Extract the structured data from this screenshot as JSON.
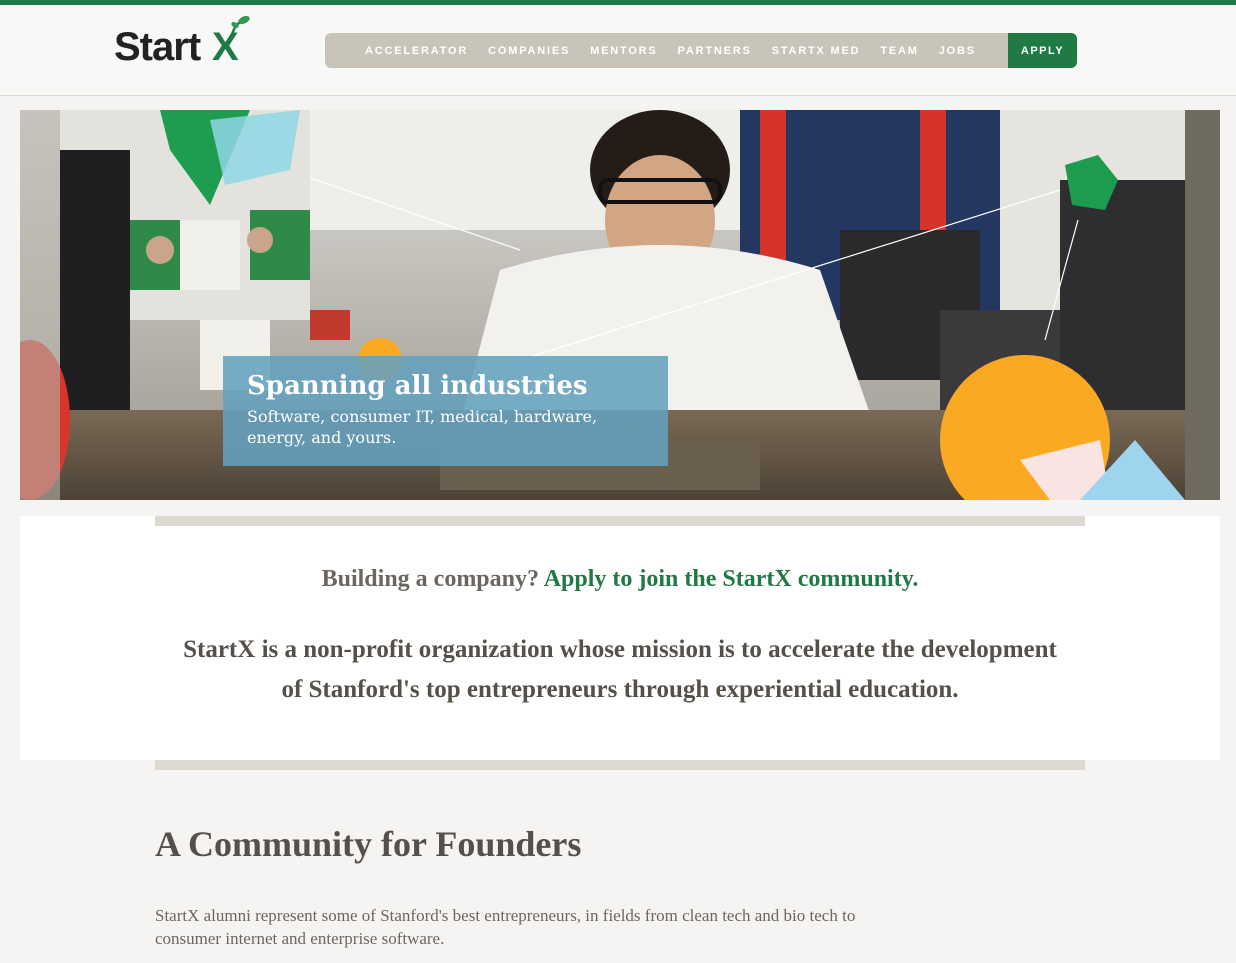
{
  "logo": {
    "text": "Start",
    "x_letter": "X",
    "icon": "sprout-leaf-icon"
  },
  "nav": {
    "items": [
      {
        "label": "ACCELERATOR"
      },
      {
        "label": "COMPANIES"
      },
      {
        "label": "MENTORS"
      },
      {
        "label": "PARTNERS"
      },
      {
        "label": "STARTX MED"
      },
      {
        "label": "TEAM"
      },
      {
        "label": "JOBS"
      }
    ],
    "apply_label": "APPLY"
  },
  "hero": {
    "title": "Spanning all industries",
    "subtitle": "Software, consumer IT, medical, hardware, energy, and yours."
  },
  "cta": {
    "lead": "Building a company?",
    "link": "Apply to join the StartX community."
  },
  "mission": "StartX is a non-profit organization whose mission is to accelerate the development of Stanford's top entrepreneurs through experiential education.",
  "community": {
    "title": "A Community for Founders",
    "text": "StartX alumni represent some of Stanford's best entrepreneurs, in fields from clean tech and bio tech to consumer internet and enterprise software."
  },
  "colors": {
    "brand_green": "#1f7a46",
    "nav_bg": "#c9c4b9",
    "hero_box": "#64a0be",
    "text_dark": "#555049"
  }
}
